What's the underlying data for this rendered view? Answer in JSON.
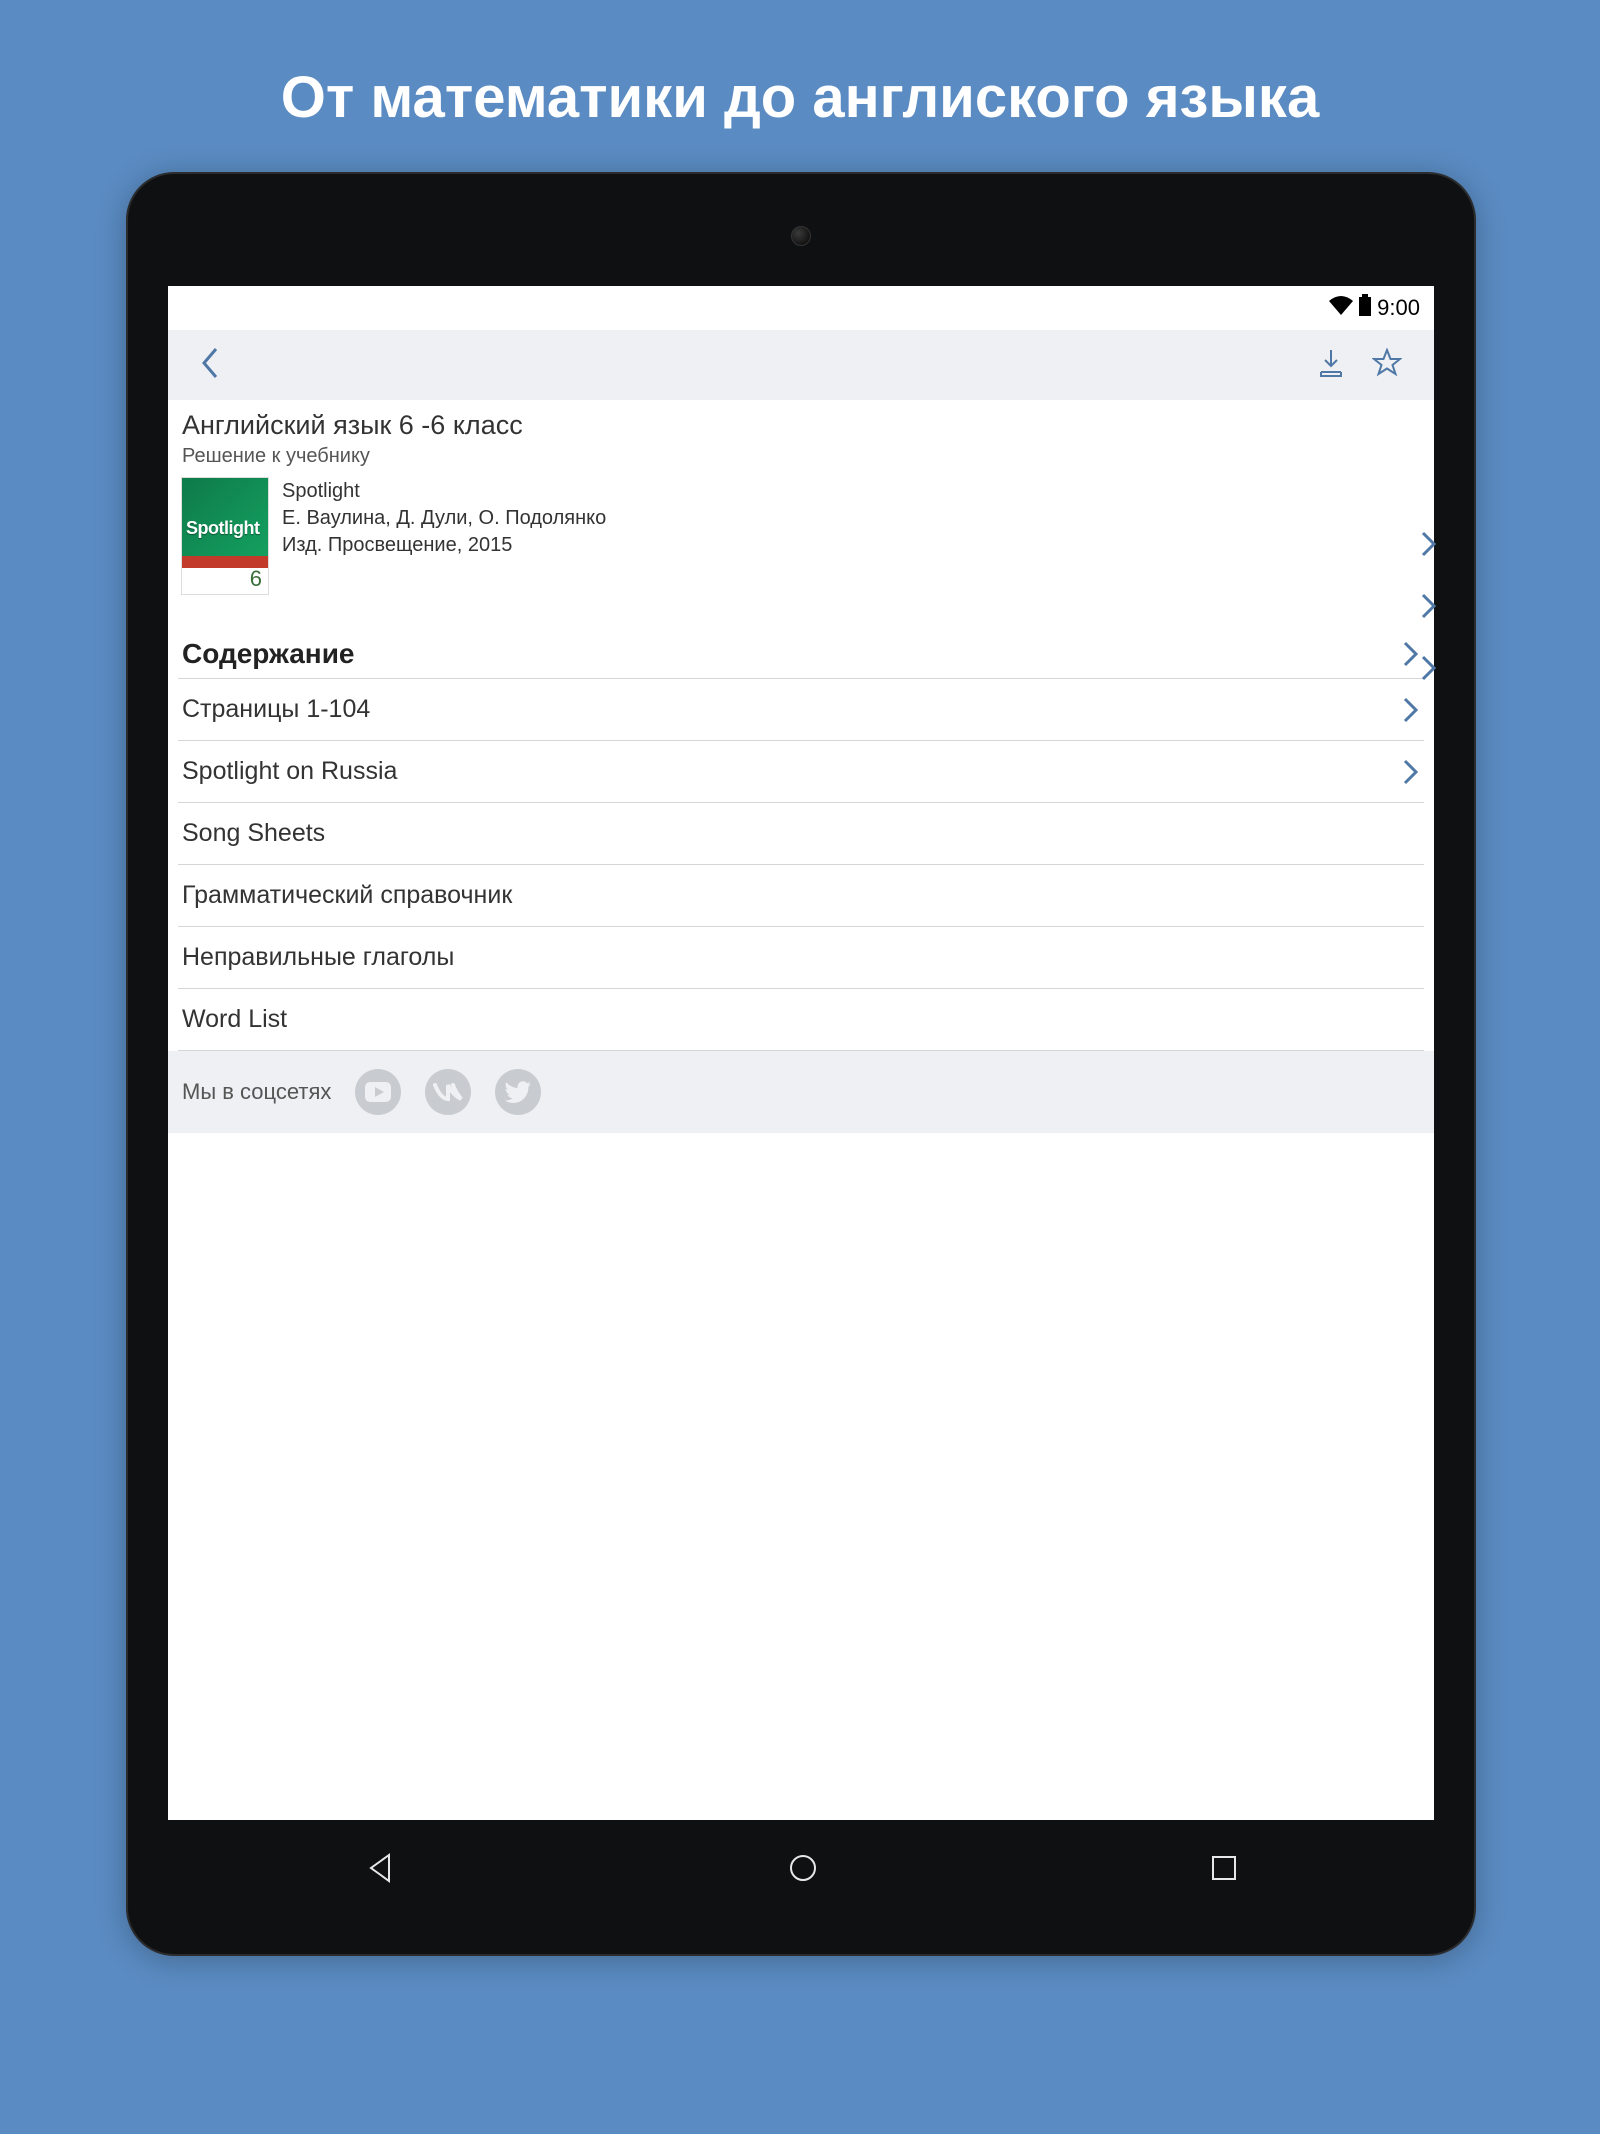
{
  "promo": {
    "title": "От математики до англиского языка"
  },
  "statusbar": {
    "time": "9:00"
  },
  "page": {
    "title": "Английский язык 6 -6 класс",
    "subtitle": "Решение к учебнику"
  },
  "book": {
    "cover_brand": "Spotlight",
    "cover_grade": "6",
    "line1": "Spotlight",
    "line2": "Е. Ваулина, Д. Дули, О. Подолянко",
    "line3": "Изд. Просвещение, 2015"
  },
  "section": {
    "header": "Содержание"
  },
  "items": [
    {
      "label": "Страницы 1-104",
      "chevron": true
    },
    {
      "label": "Spotlight on Russia",
      "chevron": true
    },
    {
      "label": "Song Sheets",
      "chevron": false
    },
    {
      "label": "Грамматический справочник",
      "chevron": false
    },
    {
      "label": "Неправильные глаголы",
      "chevron": false
    },
    {
      "label": "Word List",
      "chevron": false
    }
  ],
  "social": {
    "label": "Мы в соцсетях"
  }
}
